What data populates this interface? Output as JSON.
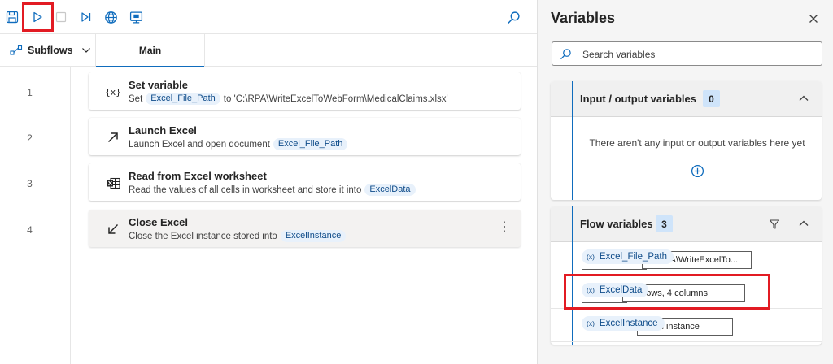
{
  "toolbar": {
    "buttons": [
      {
        "name": "save-icon"
      },
      {
        "name": "run-icon"
      },
      {
        "name": "stop-icon"
      },
      {
        "name": "run-next-action-icon"
      },
      {
        "name": "web-recorder-icon"
      },
      {
        "name": "desktop-recorder-icon"
      },
      {
        "name": "search-icon"
      }
    ]
  },
  "tabs": {
    "subflows_label": "Subflows",
    "main_label": "Main"
  },
  "actions": [
    {
      "line": "1",
      "icon": "variable-icon",
      "title": "Set variable",
      "desc_prefix": "Set",
      "chip": "Excel_File_Path",
      "desc_suffix": "to 'C:\\RPA\\WriteExcelToWebForm\\MedicalClaims.xlsx'"
    },
    {
      "line": "2",
      "icon": "launch-excel-icon",
      "title": "Launch Excel",
      "desc_prefix": "Launch Excel and open document",
      "chip": "Excel_File_Path"
    },
    {
      "line": "3",
      "icon": "excel-worksheet-icon",
      "title": "Read from Excel worksheet",
      "desc_prefix": "Read the values of all cells in worksheet and store it into",
      "chip": "ExcelData"
    },
    {
      "line": "4",
      "icon": "close-excel-icon",
      "title": "Close Excel",
      "desc_prefix": "Close the Excel instance stored into",
      "chip": "ExcelInstance"
    }
  ],
  "variables_pane": {
    "title": "Variables",
    "search_placeholder": "Search variables",
    "io_section": {
      "title": "Input / output variables",
      "count": "0",
      "empty_message": "There aren't any input or output variables here yet"
    },
    "flow_section": {
      "title": "Flow variables",
      "count": "3",
      "items": [
        {
          "name": "Excel_File_Path",
          "value": "C:\\RPA\\WriteExcelTo..."
        },
        {
          "name": "ExcelData",
          "value": "10 Rows, 4 columns"
        },
        {
          "name": "ExcelInstance",
          "value": "Excel instance"
        }
      ]
    },
    "var_prefix": "(x)"
  },
  "colors": {
    "accent": "#0f6cbd",
    "highlight": "#e21b23",
    "chip_bg": "#e8f1fb"
  }
}
